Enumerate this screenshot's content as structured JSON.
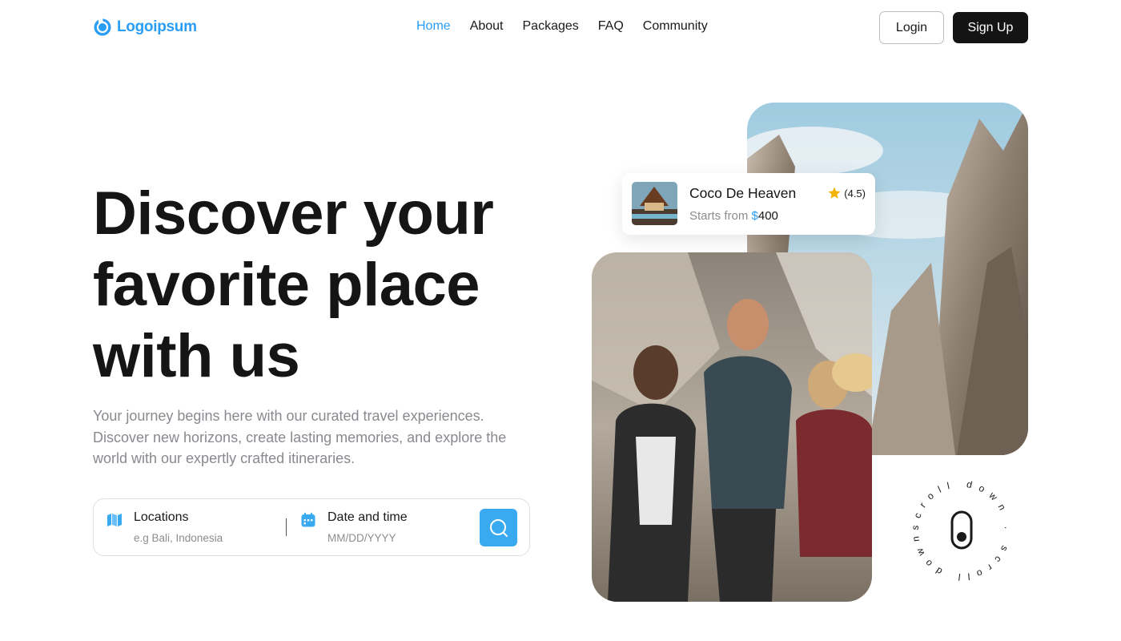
{
  "brand": {
    "name": "Logoipsum",
    "accent": "#2a9df4"
  },
  "nav": {
    "items": [
      {
        "label": "Home",
        "active": true
      },
      {
        "label": "About",
        "active": false
      },
      {
        "label": "Packages",
        "active": false
      },
      {
        "label": "FAQ",
        "active": false
      },
      {
        "label": "Community",
        "active": false
      }
    ],
    "login_label": "Login",
    "signup_label": "Sign Up"
  },
  "hero": {
    "title_lines": [
      "Discover your",
      "favorite place",
      "with us"
    ],
    "subtitle": "Your journey begins here with our curated travel experiences. Discover new horizons, create lasting memories, and explore the world with our expertly crafted itineraries."
  },
  "search": {
    "location": {
      "label": "Locations",
      "placeholder": "e.g Bali, Indonesia",
      "icon": "map-icon"
    },
    "date": {
      "label": "Date and time",
      "placeholder": "MM/DD/YYYY",
      "icon": "calendar-icon"
    },
    "button_icon": "search-icon",
    "button_color": "#3aaaf0"
  },
  "feature_card": {
    "title": "Coco De Heaven",
    "price_prefix": "Starts from ",
    "currency": "$",
    "price": "400",
    "rating": "(4.5)",
    "rating_icon": "star-icon"
  },
  "scroll_badge": {
    "text": "scroll down . scroll down . ",
    "icon": "mouse-icon"
  }
}
